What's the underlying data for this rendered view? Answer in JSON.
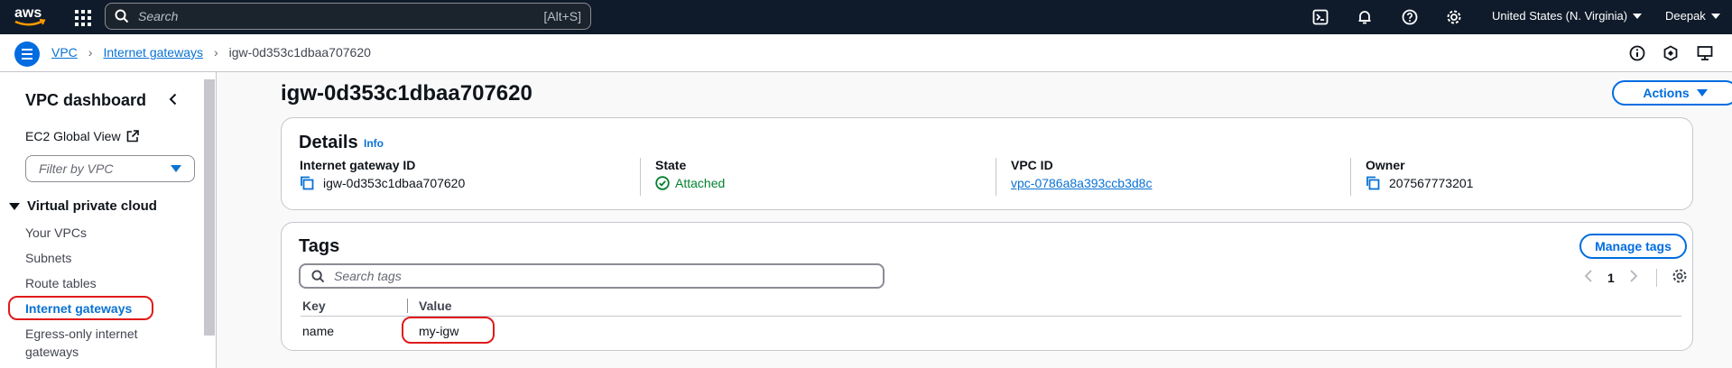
{
  "topnav": {
    "logo_text": "aws",
    "search_placeholder": "Search",
    "search_shortcut": "[Alt+S]",
    "region": "United States (N. Virginia)",
    "user": "Deepak",
    "icons": [
      "services-grid-icon",
      "cloudshell-icon",
      "bell-icon",
      "help-icon",
      "gear-icon"
    ]
  },
  "breadcrumb": {
    "items": [
      "VPC",
      "Internet gateways",
      "igw-0d353c1dbaa707620"
    ]
  },
  "sidebar": {
    "title": "VPC dashboard",
    "ec2_global_view": "EC2 Global View",
    "filter_placeholder": "Filter by VPC",
    "section": "Virtual private cloud",
    "items": [
      "Your VPCs",
      "Subnets",
      "Route tables",
      "Internet gateways",
      "Egress-only internet",
      "gateways"
    ],
    "active_item": "Internet gateways"
  },
  "main": {
    "title": "igw-0d353c1dbaa707620",
    "actions_label": "Actions",
    "details": {
      "title": "Details",
      "info": "Info",
      "fields": [
        {
          "label": "Internet gateway ID",
          "value": "igw-0d353c1dbaa707620"
        },
        {
          "label": "State",
          "value": "Attached"
        },
        {
          "label": "VPC ID",
          "value": "vpc-0786a8a393ccb3d8c"
        },
        {
          "label": "Owner",
          "value": "207567773201"
        }
      ]
    },
    "tags": {
      "title": "Tags",
      "manage_label": "Manage tags",
      "search_placeholder": "Search tags",
      "page": "1",
      "columns": [
        "Key",
        "Value"
      ],
      "rows": [
        {
          "key": "name",
          "value": "my-igw"
        }
      ]
    }
  },
  "colors": {
    "nav_bg": "#0f1b2a",
    "accent": "#006ce0",
    "link": "#0972d3",
    "success": "#00802f",
    "highlight": "#e01a1a"
  }
}
